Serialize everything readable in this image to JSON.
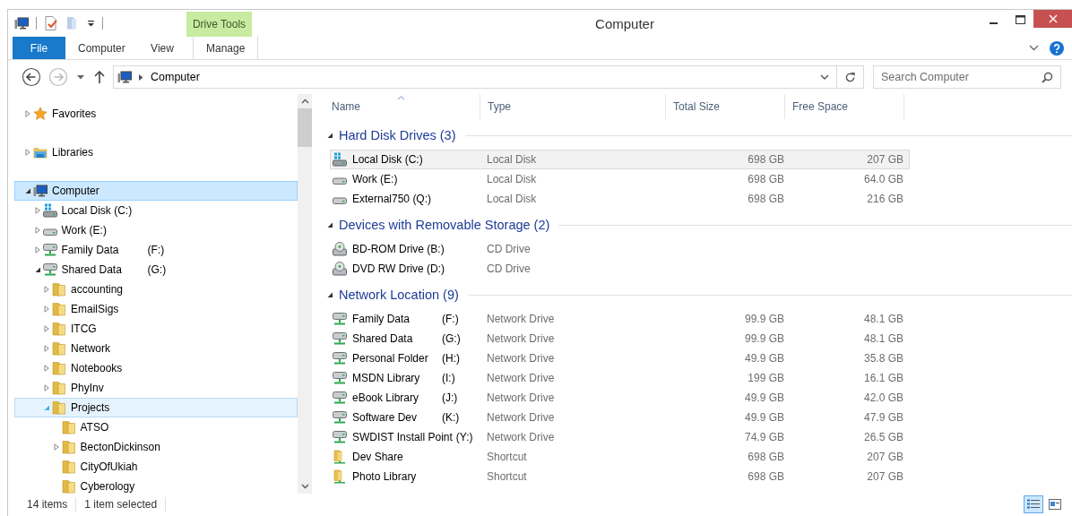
{
  "window": {
    "title": "Computer"
  },
  "contextual_tab": {
    "label": "Drive Tools"
  },
  "ribbon_tabs": [
    {
      "label": "File",
      "kind": "file"
    },
    {
      "label": "Computer",
      "kind": "tab"
    },
    {
      "label": "View",
      "kind": "tab"
    },
    {
      "label": "Manage",
      "kind": "contextual"
    }
  ],
  "address_bar": {
    "path": [
      "Computer"
    ]
  },
  "search": {
    "placeholder": "Search Computer"
  },
  "navigation": [
    {
      "label": "Favorites",
      "kind": "favorites",
      "expandable": true,
      "expanded": false,
      "selected": false,
      "hot": false
    },
    {
      "label": "Libraries",
      "kind": "libraries",
      "expandable": true,
      "expanded": false,
      "selected": false,
      "hot": false
    },
    {
      "label": "Computer",
      "kind": "computer",
      "expandable": true,
      "expanded": true,
      "selected": true,
      "hot": false,
      "children": [
        {
          "label": "Local Disk (C:)",
          "kind": "system-disk",
          "expandable": true,
          "expanded": false,
          "selected": false,
          "hot": false
        },
        {
          "label": "Work (E:)",
          "kind": "disk",
          "expandable": true,
          "expanded": false,
          "selected": false,
          "hot": false
        },
        {
          "label": "Family Data",
          "drive": "(F:)",
          "kind": "network",
          "expandable": true,
          "expanded": false,
          "selected": false,
          "hot": false
        },
        {
          "label": "Shared Data",
          "drive": "(G:)",
          "kind": "network",
          "expandable": true,
          "expanded": true,
          "selected": false,
          "hot": false,
          "children": [
            {
              "label": "accounting",
              "kind": "folder",
              "expandable": true,
              "expanded": false,
              "selected": false,
              "hot": false
            },
            {
              "label": "EmailSigs",
              "kind": "folder",
              "expandable": true,
              "expanded": false,
              "selected": false,
              "hot": false
            },
            {
              "label": "ITCG",
              "kind": "folder",
              "expandable": true,
              "expanded": false,
              "selected": false,
              "hot": false
            },
            {
              "label": "Network",
              "kind": "folder",
              "expandable": true,
              "expanded": false,
              "selected": false,
              "hot": false
            },
            {
              "label": "Notebooks",
              "kind": "folder",
              "expandable": true,
              "expanded": false,
              "selected": false,
              "hot": false
            },
            {
              "label": "PhyInv",
              "kind": "folder",
              "expandable": true,
              "expanded": false,
              "selected": false,
              "hot": false
            },
            {
              "label": "Projects",
              "kind": "folder",
              "expandable": true,
              "expanded": true,
              "selected": false,
              "hot": true,
              "children": [
                {
                  "label": "ATSO",
                  "kind": "folder",
                  "expandable": false,
                  "selected": false,
                  "hot": false
                },
                {
                  "label": "BectonDickinson",
                  "kind": "folder",
                  "expandable": true,
                  "expanded": false,
                  "selected": false,
                  "hot": false
                },
                {
                  "label": "CityOfUkiah",
                  "kind": "folder",
                  "expandable": false,
                  "selected": false,
                  "hot": false
                },
                {
                  "label": "Cyberology",
                  "kind": "folder",
                  "expandable": false,
                  "selected": false,
                  "hot": false
                }
              ]
            }
          ]
        }
      ]
    }
  ],
  "columns": [
    {
      "label": "Name",
      "sorted": true
    },
    {
      "label": "Type",
      "sorted": false
    },
    {
      "label": "Total Size",
      "sorted": false
    },
    {
      "label": "Free Space",
      "sorted": false
    }
  ],
  "groups": [
    {
      "title": "Hard Disk Drives (3)",
      "expanded": true,
      "items": [
        {
          "name": "Local Disk (C:)",
          "kind": "system-disk",
          "type": "Local Disk",
          "total_size": "698 GB",
          "free_space": "207 GB",
          "selected": true
        },
        {
          "name": "Work (E:)",
          "kind": "disk",
          "type": "Local Disk",
          "total_size": "698 GB",
          "free_space": "64.0 GB",
          "selected": false
        },
        {
          "name": "External750 (Q:)",
          "kind": "disk",
          "type": "Local Disk",
          "total_size": "698 GB",
          "free_space": "216 GB",
          "selected": false
        }
      ]
    },
    {
      "title": "Devices with Removable Storage (2)",
      "expanded": true,
      "items": [
        {
          "name": "BD-ROM Drive (B:)",
          "kind": "optical",
          "type": "CD Drive",
          "selected": false
        },
        {
          "name": "DVD RW Drive (D:)",
          "kind": "optical",
          "type": "CD Drive",
          "selected": false
        }
      ]
    },
    {
      "title": "Network Location (9)",
      "expanded": true,
      "items": [
        {
          "name": "Family Data",
          "drive": "(F:)",
          "kind": "network",
          "type": "Network Drive",
          "total_size": "99.9 GB",
          "free_space": "48.1 GB",
          "selected": false
        },
        {
          "name": "Shared Data",
          "drive": "(G:)",
          "kind": "network",
          "type": "Network Drive",
          "total_size": "99.9 GB",
          "free_space": "48.1 GB",
          "selected": false
        },
        {
          "name": "Personal Folder",
          "drive": "(H:)",
          "kind": "network",
          "type": "Network Drive",
          "total_size": "49.9 GB",
          "free_space": "35.8 GB",
          "selected": false
        },
        {
          "name": "MSDN Library",
          "drive": "(I:)",
          "kind": "network",
          "type": "Network Drive",
          "total_size": "199 GB",
          "free_space": "16.1 GB",
          "selected": false
        },
        {
          "name": "eBook Library",
          "drive": "(J:)",
          "kind": "network",
          "type": "Network Drive",
          "total_size": "49.9 GB",
          "free_space": "42.0 GB",
          "selected": false
        },
        {
          "name": "Software Dev",
          "drive": "(K:)",
          "kind": "network",
          "type": "Network Drive",
          "total_size": "49.9 GB",
          "free_space": "47.9 GB",
          "selected": false
        },
        {
          "name": "SWDIST Install Point",
          "drive": "(Y:)",
          "kind": "network",
          "type": "Network Drive",
          "total_size": "74.9 GB",
          "free_space": "26.5 GB",
          "selected": false
        },
        {
          "name": "Dev Share",
          "kind": "shortcut",
          "type": "Shortcut",
          "total_size": "698 GB",
          "free_space": "207 GB",
          "selected": false
        },
        {
          "name": "Photo Library",
          "kind": "shortcut",
          "type": "Shortcut",
          "total_size": "698 GB",
          "free_space": "207 GB",
          "selected": false
        }
      ]
    }
  ],
  "status_bar": {
    "item_count": "14 items",
    "selection": "1 item selected"
  },
  "view_buttons": [
    {
      "kind": "details",
      "selected": true
    },
    {
      "kind": "tiles",
      "selected": false
    }
  ]
}
